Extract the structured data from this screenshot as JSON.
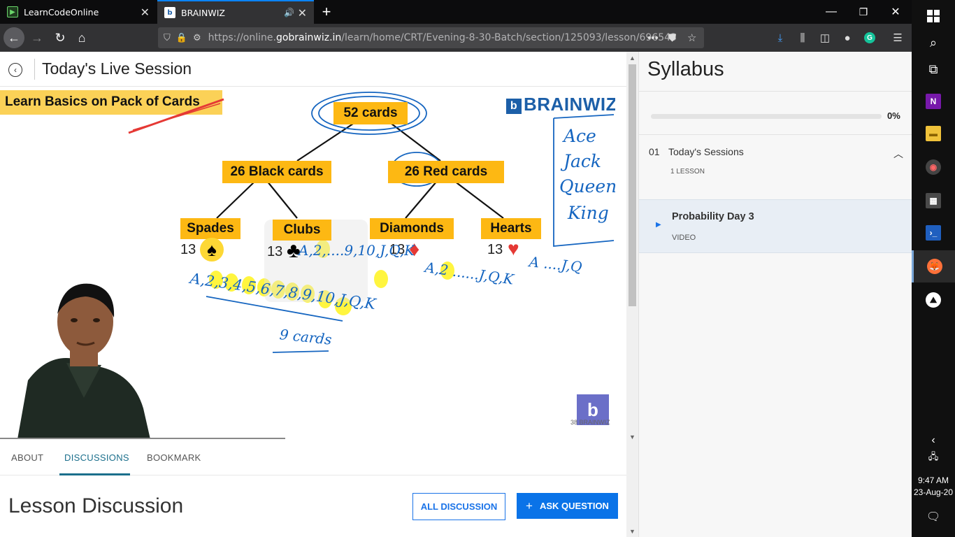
{
  "browser": {
    "tabs": [
      {
        "label": "LearnCodeOnline",
        "active": false
      },
      {
        "label": "BRAINWIZ",
        "active": true
      }
    ],
    "url_prefix": "https://online.",
    "url_domain": "gobrainwiz.in",
    "url_path": "/learn/home/CRT/Evening-8-30-Batch/section/125093/lesson/696543"
  },
  "header": {
    "title": "Today's Live Session"
  },
  "whiteboard": {
    "banner": "Learn Basics on  Pack of Cards",
    "logo": "BRAINWIZ",
    "root": "52 cards",
    "black": "26 Black cards",
    "red": "26 Red cards",
    "suits": [
      "Spades",
      "Clubs",
      "Diamonds",
      "Hearts"
    ],
    "counts": [
      "13",
      "13",
      "13",
      "13"
    ],
    "handwritten": {
      "faces": [
        "Ace",
        "Jack",
        "Queen",
        "King"
      ],
      "black_seq": "A,2,3,4,5,6,7,8,9,10,J,Q,K",
      "mid_seq": "A,2,....9,10,J,Q,K",
      "diamond_seq": "A,2 ......J,Q,K",
      "heart_seq": "A ....J,Q",
      "nine_cards": "9 cards"
    },
    "watermark": "b",
    "watermark_label": "38 BRAINWIZ"
  },
  "content_tabs": [
    "ABOUT",
    "DISCUSSIONS",
    "BOOKMARK"
  ],
  "active_tab": "DISCUSSIONS",
  "discussion": {
    "title": "Lesson Discussion",
    "all_btn": "ALL DISCUSSION",
    "ask_btn": "ASK QUESTION"
  },
  "syllabus": {
    "title": "Syllabus",
    "progress": 0,
    "progress_label": "0%",
    "section": {
      "number": "01",
      "name": "Today's Sessions",
      "count": "1 LESSON"
    },
    "lesson": {
      "name": "Probability Day 3",
      "type": "VIDEO"
    }
  },
  "taskbar": {
    "time": "9:47 AM",
    "date": "23-Aug-20"
  },
  "colors": {
    "accent": "#1a73e8",
    "box": "#fdb813",
    "ink": "#1565c0"
  }
}
